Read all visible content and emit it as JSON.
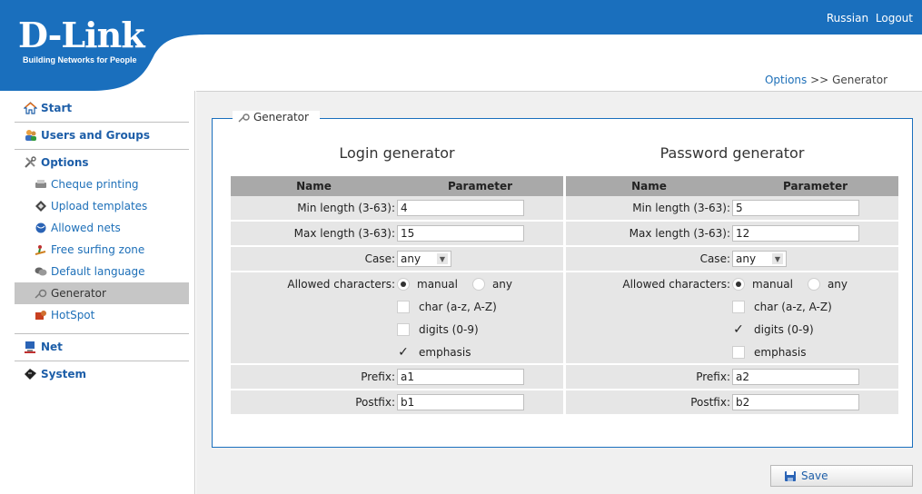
{
  "header": {
    "logo": "D-Link",
    "tagline": "Building Networks for People",
    "links": [
      "Russian",
      "Logout"
    ]
  },
  "breadcrumb": {
    "section": "Options",
    "separator": ">>",
    "page": "Generator"
  },
  "sidebar": {
    "sections": [
      {
        "label": "Start",
        "icon": "home-icon"
      },
      {
        "label": "Users and Groups",
        "icon": "users-icon"
      },
      {
        "label": "Options",
        "icon": "tools-icon",
        "items": [
          {
            "label": "Cheque printing",
            "icon": "printer-icon"
          },
          {
            "label": "Upload templates",
            "icon": "template-icon"
          },
          {
            "label": "Allowed nets",
            "icon": "globe-icon"
          },
          {
            "label": "Free surfing zone",
            "icon": "surfer-icon"
          },
          {
            "label": "Default language",
            "icon": "language-icon"
          },
          {
            "label": "Generator",
            "icon": "generator-icon",
            "active": true
          },
          {
            "label": "HotSpot",
            "icon": "hotspot-icon"
          }
        ]
      },
      {
        "label": "Net",
        "icon": "network-icon"
      },
      {
        "label": "System",
        "icon": "system-icon"
      }
    ]
  },
  "panel": {
    "legend": "Generator",
    "columns": {
      "name": "Name",
      "parameter": "Parameter"
    },
    "labels": {
      "min_length": "Min length (3-63):",
      "max_length": "Max length (3-63):",
      "case": "Case:",
      "allowed": "Allowed characters:",
      "prefix": "Prefix:",
      "postfix": "Postfix:"
    },
    "options": {
      "manual": "manual",
      "any": "any",
      "chars": "char (a-z, A-Z)",
      "digits": "digits (0-9)",
      "emphasis": "emphasis"
    },
    "login": {
      "title": "Login generator",
      "min_length": "4",
      "max_length": "15",
      "case": "any",
      "mode": "manual",
      "chars": false,
      "digits": false,
      "emphasis": true,
      "prefix": "a1",
      "postfix": "b1"
    },
    "password": {
      "title": "Password generator",
      "min_length": "5",
      "max_length": "12",
      "case": "any",
      "mode": "manual",
      "chars": false,
      "digits": true,
      "emphasis": false,
      "prefix": "a2",
      "postfix": "b2"
    }
  },
  "actions": {
    "save": "Save"
  },
  "colors": {
    "brand": "#1a6fbd",
    "link": "#1d6fb8",
    "header_row": "#a9a9a9",
    "row": "#e6e6e6"
  }
}
